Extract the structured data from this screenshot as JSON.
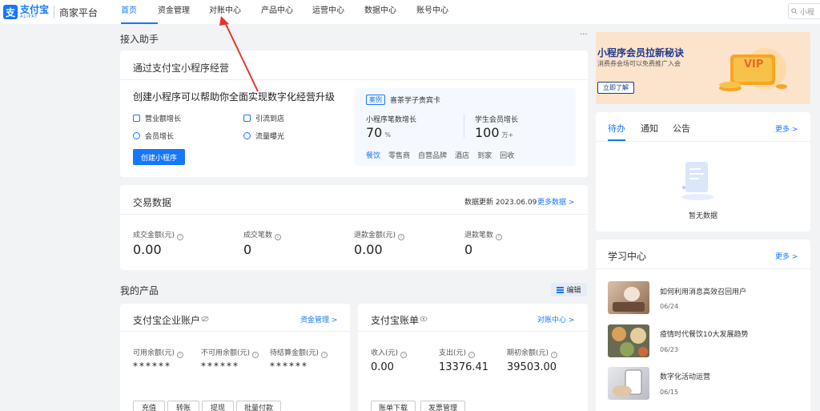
{
  "header": {
    "logo_mark": "支",
    "logo_cn": "支付宝",
    "logo_en": "ALIPAY",
    "platform": "商家平台",
    "nav": [
      "首页",
      "资金管理",
      "对账中心",
      "产品中心",
      "运营中心",
      "数据中心",
      "账号中心"
    ],
    "search_placeholder": "小程"
  },
  "assistant": {
    "section_title": "接入助手",
    "more_dots": "···",
    "card_title": "通过支付宝小程序经营",
    "headline": "创建小程序可以帮助你全面实现数字化经营升级",
    "features": [
      "营业额增长",
      "引流到店",
      "会员增长",
      "流量曝光"
    ],
    "button": "创建小程序",
    "case": {
      "tag": "案例",
      "name": "喜茶学子贵宾卡",
      "stat1_label": "小程序笔数增长",
      "stat1_value": "70",
      "stat1_unit": "%",
      "stat2_label": "学生会员增长",
      "stat2_value": "100",
      "stat2_unit": "万+",
      "categories": [
        "餐饮",
        "零售商",
        "自营品牌",
        "酒店",
        "到家",
        "回收"
      ]
    }
  },
  "trade": {
    "title": "交易数据",
    "updated": "数据更新 2023.06.09",
    "more": "更多数据 >",
    "metrics": [
      {
        "label": "成交金额(元)",
        "value": "0.00"
      },
      {
        "label": "成交笔数",
        "value": "0"
      },
      {
        "label": "退款金额(元)",
        "value": "0.00"
      },
      {
        "label": "退款笔数",
        "value": "0"
      }
    ]
  },
  "products": {
    "section_title": "我的产品",
    "edit": "编辑",
    "account": {
      "title": "支付宝企业账户",
      "link": "资金管理 >",
      "items": [
        {
          "label": "可用余额(元)",
          "value": "******"
        },
        {
          "label": "不可用余额(元)",
          "value": "******"
        },
        {
          "label": "待结算金额(元)",
          "value": "******"
        }
      ],
      "buttons": [
        "充值",
        "转账",
        "提现",
        "批量付款"
      ]
    },
    "bill": {
      "title": "支付宝账单",
      "link": "对账中心 >",
      "items": [
        {
          "label": "收入(元)",
          "value": "0.00"
        },
        {
          "label": "支出(元)",
          "value": "13376.41"
        },
        {
          "label": "期初余额(元)",
          "value": "39503.00"
        }
      ],
      "buttons": [
        "账单下载",
        "发票管理"
      ]
    }
  },
  "banner": {
    "title": "小程序会员拉新秘诀",
    "subtitle": "消费券会场可以免费推广入会",
    "button": "立即了解",
    "badge": "VIP"
  },
  "todo": {
    "tabs": [
      "待办",
      "通知",
      "公告"
    ],
    "more": "更多 >",
    "empty": "暂无数据"
  },
  "learning": {
    "title": "学习中心",
    "more": "更多 >",
    "items": [
      {
        "title": "如何利用消息高效召回用户",
        "date": "06/24"
      },
      {
        "title": "疫情时代餐饮10大发展趋势",
        "date": "06/23"
      },
      {
        "title": "数字化活动运营",
        "date": "06/15"
      }
    ]
  },
  "colors": {
    "accent": "#1677ff",
    "annotation": "#e8332a",
    "banner_bg": "#fbe3cc"
  }
}
